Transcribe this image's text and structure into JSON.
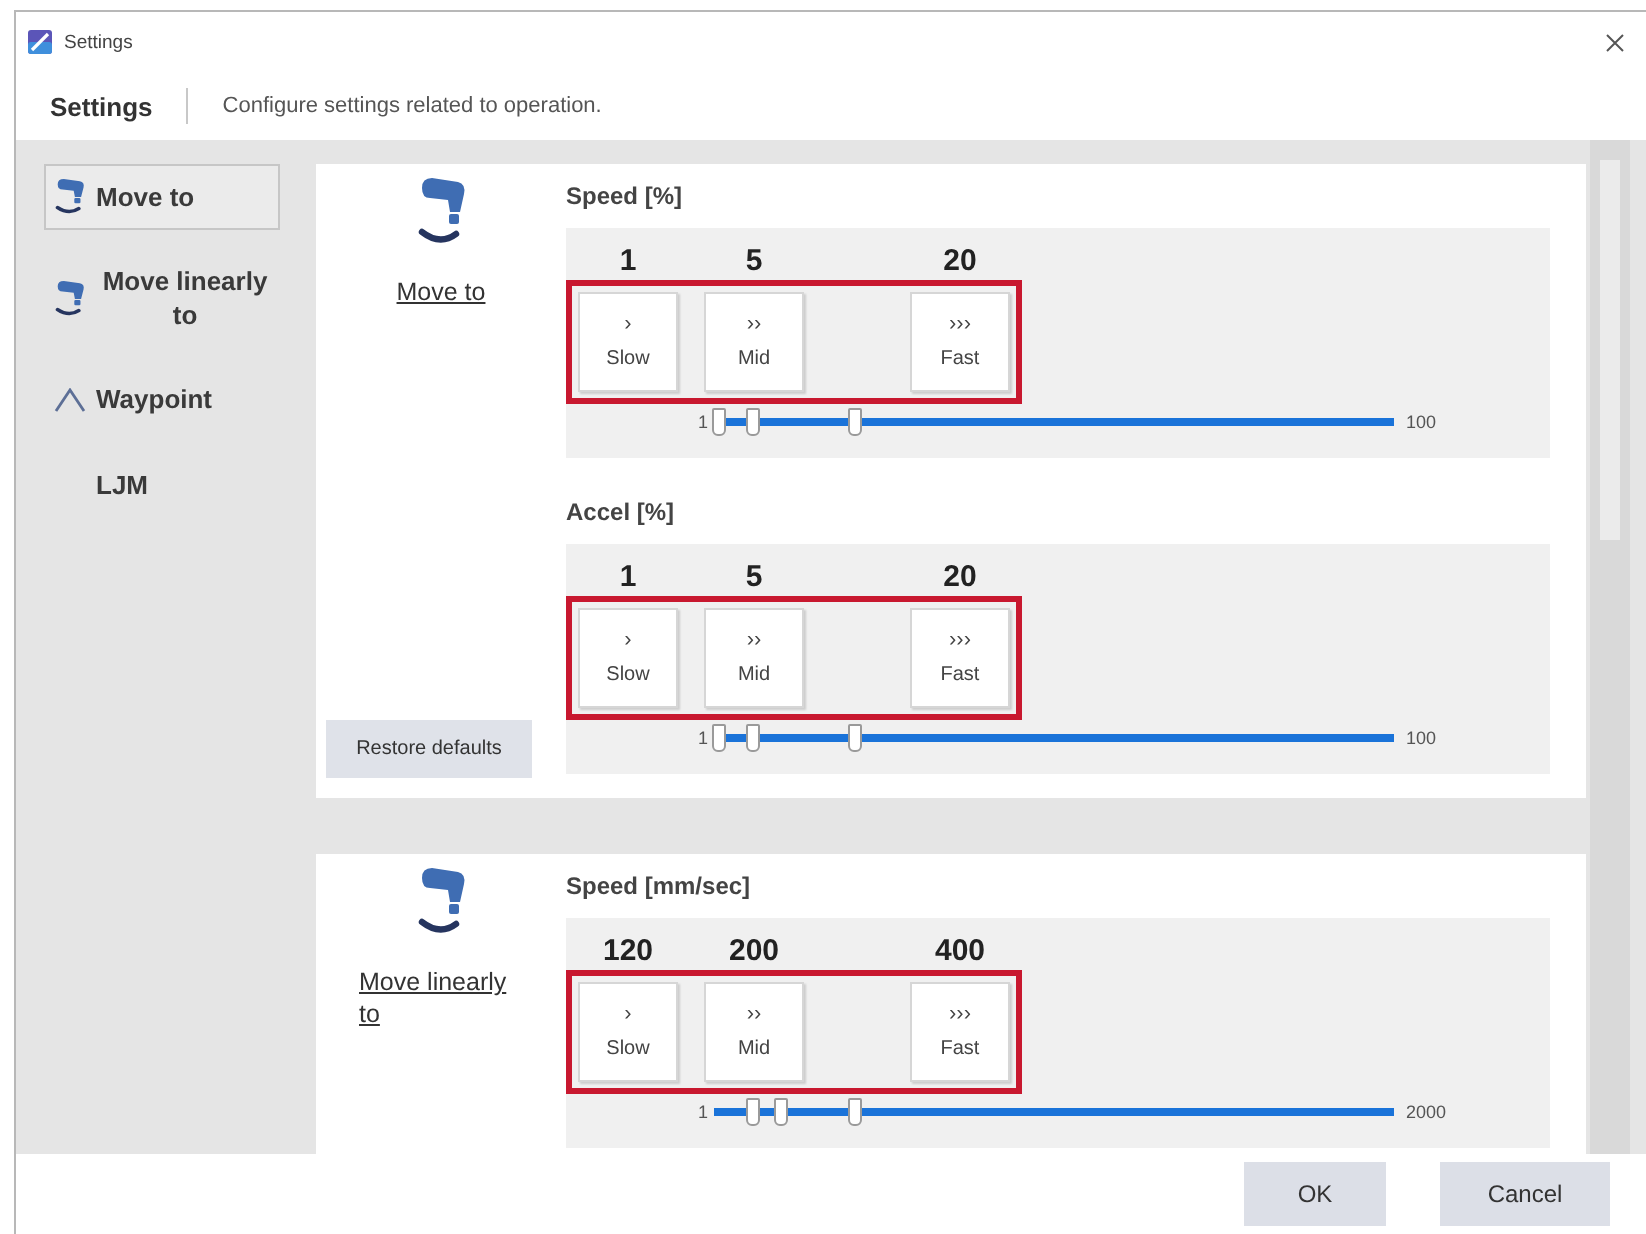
{
  "window": {
    "title": "Settings"
  },
  "header": {
    "title": "Settings",
    "description": "Configure settings related to operation."
  },
  "sidebar": {
    "items": [
      {
        "label": "Move to",
        "kind": "robot",
        "selected": true
      },
      {
        "label": "Move linearly to",
        "kind": "robot",
        "selected": false
      },
      {
        "label": "Waypoint",
        "kind": "waypoint",
        "selected": false
      },
      {
        "label": "LJM",
        "kind": "plain",
        "selected": false
      }
    ]
  },
  "sections": [
    {
      "title": "Move to",
      "restore_button": "Restore defaults",
      "settings": [
        {
          "label": "Speed [%]",
          "highlighted": true,
          "presets": [
            {
              "value": "1",
              "symbol": "›",
              "label": "Slow"
            },
            {
              "value": "5",
              "symbol": "››",
              "label": "Mid"
            },
            {
              "value": "20",
              "symbol": "›››",
              "label": "Fast"
            }
          ],
          "slider": {
            "min": "1",
            "max": "100",
            "thumbs": [
              {
                "level": 0.01
              },
              {
                "level": 0.06
              },
              {
                "level": 0.21
              }
            ]
          }
        },
        {
          "label": "Accel [%]",
          "highlighted": true,
          "presets": [
            {
              "value": "1",
              "symbol": "›",
              "label": "Slow"
            },
            {
              "value": "5",
              "symbol": "››",
              "label": "Mid"
            },
            {
              "value": "20",
              "symbol": "›››",
              "label": "Fast"
            }
          ],
          "slider": {
            "min": "1",
            "max": "100",
            "thumbs": [
              {
                "level": 0.01
              },
              {
                "level": 0.06
              },
              {
                "level": 0.21
              }
            ]
          }
        }
      ]
    },
    {
      "title": "Move linearly to",
      "settings": [
        {
          "label": "Speed [mm/sec]",
          "highlighted": true,
          "presets": [
            {
              "value": "120",
              "symbol": "›",
              "label": "Slow"
            },
            {
              "value": "200",
              "symbol": "››",
              "label": "Mid"
            },
            {
              "value": "400",
              "symbol": "›››",
              "label": "Fast"
            }
          ],
          "slider": {
            "min": "1",
            "max": "2000",
            "thumbs": [
              {
                "level": 0.06
              },
              {
                "level": 0.1
              },
              {
                "level": 0.21
              }
            ]
          }
        }
      ]
    }
  ],
  "buttons": [
    {
      "label": "OK"
    },
    {
      "label": "Cancel"
    }
  ]
}
